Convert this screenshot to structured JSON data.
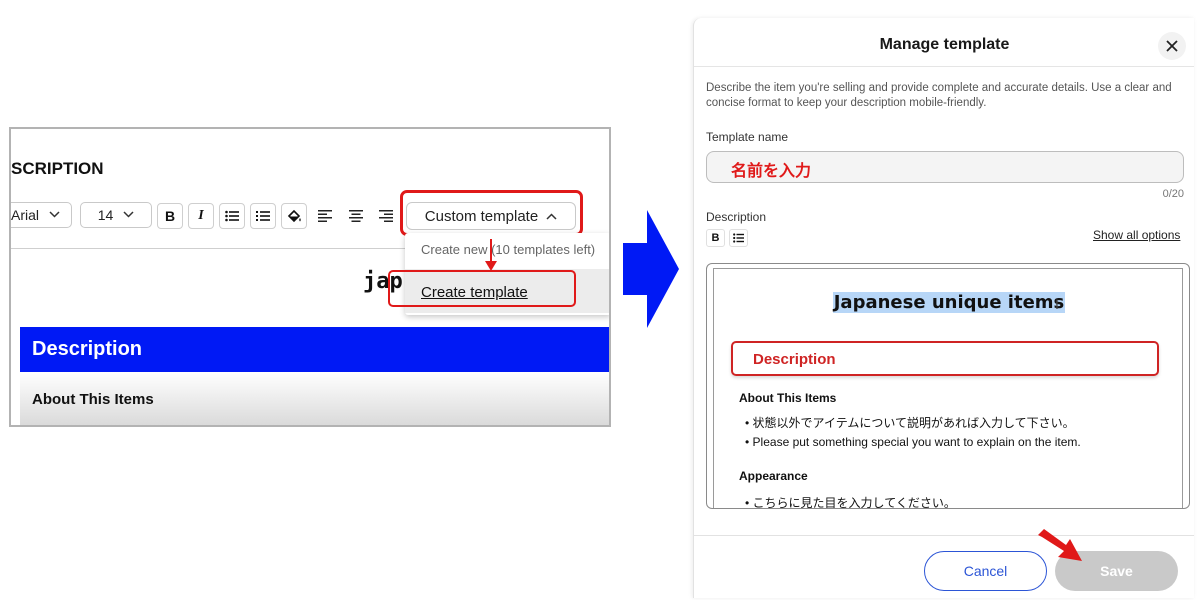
{
  "left_editor": {
    "heading": "SCRIPTION",
    "font_family_value": "Arial",
    "font_size_value": "14",
    "toolbar_icons": [
      "bold-icon",
      "italic-icon",
      "bullet-list-icon",
      "numbered-list-icon",
      "fill-color-icon",
      "align-left-icon",
      "align-center-icon",
      "align-right-icon"
    ],
    "bold_glyph": "B",
    "italic_glyph": "I",
    "custom_template_label": "Custom template",
    "dropdown": {
      "note": "Create new (10 templates left)",
      "create_label": "Create template"
    },
    "preview_title_fragment": "jap",
    "description_bar": "Description",
    "about_heading": "About This Items"
  },
  "modal": {
    "title": "Manage template",
    "intro": "Describe the item you're selling and provide complete and accurate details. Use a clear and concise format to keep your description mobile-friendly.",
    "template_name_label": "Template name",
    "template_name_value": "名前を入力",
    "char_counter": "0/20",
    "description_label": "Description",
    "bold_glyph": "B",
    "show_all_options": "Show all options",
    "editor": {
      "title": "Japanese unique items",
      "cursor_glyph": "I",
      "description_box": "Description",
      "about_heading": "About This Items",
      "about_bullets": [
        "状態以外でアイテムについて説明があれば入力して下さい。",
        "Please put something special you want to explain on the item."
      ],
      "appearance_heading": "Appearance",
      "appearance_bullets": [
        "こちらに見た目を入力してください。"
      ]
    },
    "cancel_label": "Cancel",
    "save_label": "Save"
  },
  "colors": {
    "highlight_red": "#e01919",
    "arrow_blue": "#0019f5",
    "description_bar_blue": "#0019f5",
    "selection_blue": "#b7d6f7",
    "cancel_blue": "#2c55d6",
    "save_disabled_gray": "#c9c9c9"
  }
}
